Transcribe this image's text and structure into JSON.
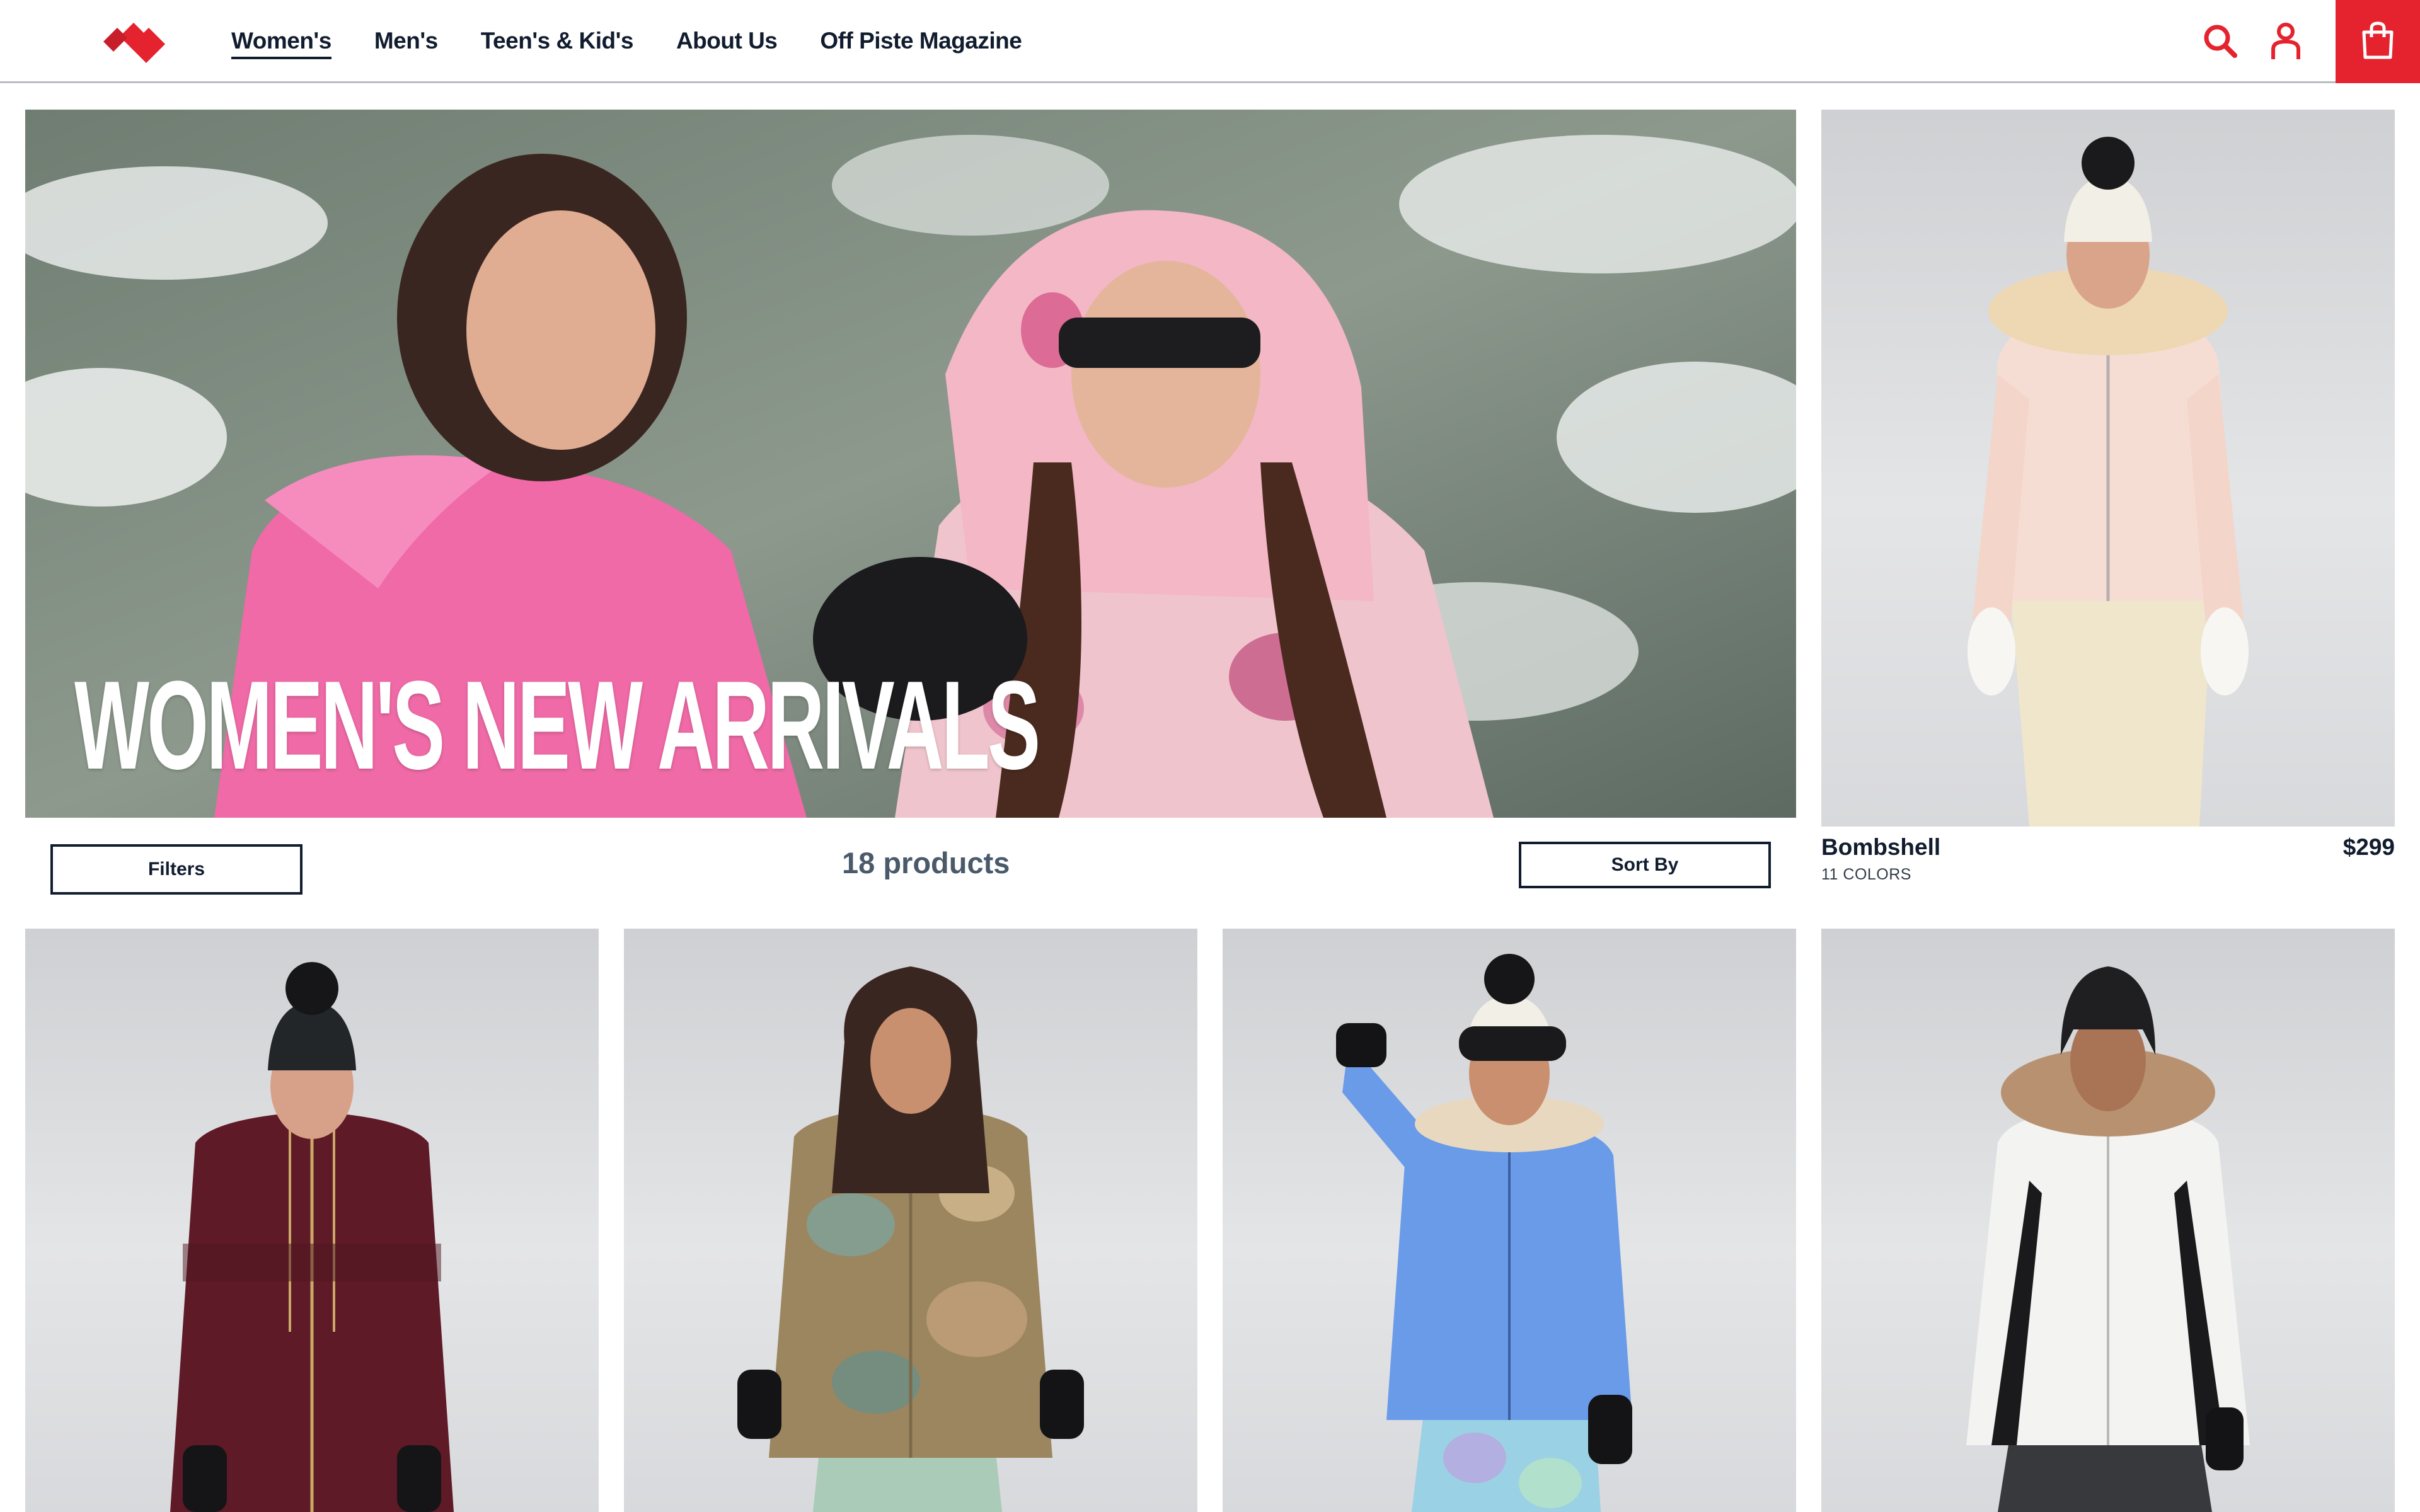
{
  "header": {
    "nav": [
      {
        "label": "Women's",
        "active": true
      },
      {
        "label": "Men's",
        "active": false
      },
      {
        "label": "Teen's & Kid's",
        "active": false
      },
      {
        "label": "About Us",
        "active": false
      },
      {
        "label": "Off Piste Magazine",
        "active": false
      }
    ],
    "icons": [
      "search-icon",
      "user-icon",
      "shopping-bag-icon"
    ],
    "accent_color": "#e4232f",
    "text_color": "#111c2e"
  },
  "hero": {
    "title": "WOMEN'S NEW ARRIVALS"
  },
  "toolbar": {
    "filters_label": "Filters",
    "product_count": "18 products",
    "sort_label": "Sort By"
  },
  "products": [
    {
      "name": "Bombshell",
      "price": "$299",
      "colors": "11 COLORS",
      "jacket_color": "#f6ddd3",
      "hat_color": "#f2efe6"
    },
    {
      "name": "",
      "price": "",
      "colors": "",
      "jacket_color": "#5e1a26",
      "hat_color": "#232629"
    },
    {
      "name": "",
      "price": "",
      "colors": "",
      "jacket_color": "#9c8660",
      "hat_color": ""
    },
    {
      "name": "",
      "price": "",
      "colors": "",
      "jacket_color": "#6a9be8",
      "hat_color": "#f2efe6"
    },
    {
      "name": "",
      "price": "",
      "colors": "",
      "jacket_color": "#f3f3f1",
      "hat_color": "#1f1f22"
    }
  ]
}
